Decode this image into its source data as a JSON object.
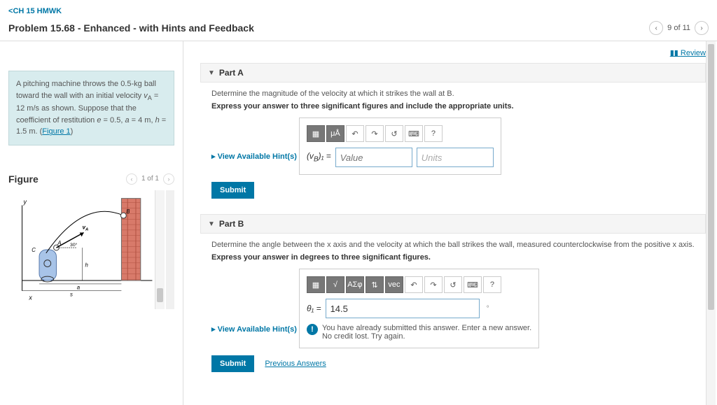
{
  "back_link": "CH 15 HMWK",
  "title": "Problem 15.68 - Enhanced - with Hints and Feedback",
  "counter": "9 of 11",
  "problem": {
    "t1": "A pitching machine throws the 0.5-kg ball toward the wall with an initial velocity ",
    "sym1": "v",
    "sub1": "A",
    "eq1": " = 12 m/s as shown. Suppose that the coefficient of restitution ",
    "sym2": "e",
    "eq2": " = 0.5, ",
    "sym3": "a",
    "eq3": " = 4 m, ",
    "sym4": "h",
    "eq4": " = 1.5 m. (",
    "figlink": "Figure 1",
    "t5": ")"
  },
  "figure_title": "Figure",
  "figure_counter": "1 of 1",
  "review": "Review",
  "partA": {
    "title": "Part A",
    "instruction": "Determine the magnitude of the velocity at which it strikes the wall at B.",
    "bold": "Express your answer to three significant figures and include the appropriate units.",
    "hints": "View Available Hint(s)",
    "var": "(v",
    "sub": "B",
    "after": ")₁ = ",
    "value_ph": "Value",
    "units_ph": "Units",
    "submit": "Submit"
  },
  "partB": {
    "title": "Part B",
    "instruction": "Determine the angle between the x axis and the velocity at which the ball strikes the wall, measured counterclockwise from the positive x axis.",
    "bold": "Express your answer in degrees to three significant figures.",
    "hints": "View Available Hint(s)",
    "var": "θ₁ = ",
    "value": "14.5",
    "unit": "°",
    "feedback1": "You have already submitted this answer. Enter a new answer.",
    "feedback2": "No credit lost. Try again.",
    "submit": "Submit",
    "prev": "Previous Answers"
  },
  "icons": {
    "mua": "μÅ",
    "undo": "↶",
    "redo": "↷",
    "reset": "↺",
    "kbd": "⌨",
    "help": "?",
    "sqrt": "√",
    "sigma": "ΑΣφ",
    "arrows": "⇅",
    "vec": "vec"
  }
}
